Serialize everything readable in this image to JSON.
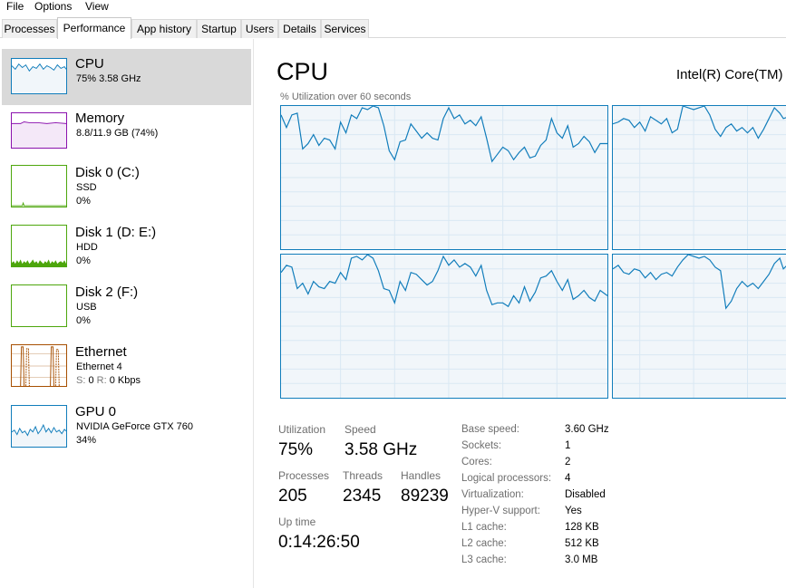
{
  "menu": [
    "File",
    "Options",
    "View"
  ],
  "tabs": [
    {
      "label": "Processes",
      "active": false
    },
    {
      "label": "Performance",
      "active": true
    },
    {
      "label": "App history",
      "active": false
    },
    {
      "label": "Startup",
      "active": false
    },
    {
      "label": "Users",
      "active": false
    },
    {
      "label": "Details",
      "active": false
    },
    {
      "label": "Services",
      "active": false
    }
  ],
  "sidebar": {
    "items": [
      {
        "title": "CPU",
        "line1": "75% 3.58 GHz",
        "color": "#117dbb",
        "icon": "cpu-graph"
      },
      {
        "title": "Memory",
        "line1": "8.8/11.9 GB (74%)",
        "color": "#8b12ae",
        "icon": "memory-graph"
      },
      {
        "title": "Disk 0 (C:)",
        "line1": "SSD",
        "line2": "0%",
        "color": "#4da60c",
        "icon": "disk-graph"
      },
      {
        "title": "Disk 1 (D: E:)",
        "line1": "HDD",
        "line2": "0%",
        "color": "#4da60c",
        "icon": "disk-graph"
      },
      {
        "title": "Disk 2 (F:)",
        "line1": "USB",
        "line2": "0%",
        "color": "#4da60c",
        "icon": "disk-graph"
      },
      {
        "title": "Ethernet",
        "line1": "Ethernet 4",
        "send_label": "S:",
        "send_value": "0",
        "recv_label": "R:",
        "recv_value": "0 Kbps",
        "color": "#a74f01",
        "icon": "network-graph"
      },
      {
        "title": "GPU 0",
        "line1": "NVIDIA GeForce GTX 760",
        "line2": "34%",
        "color": "#117dbb",
        "icon": "gpu-graph"
      }
    ]
  },
  "main": {
    "title": "CPU",
    "model": "Intel(R) Core(TM)",
    "util_label": "% Utilization over 60 seconds",
    "graph_color": "#117dbb",
    "stats": {
      "utilization": {
        "label": "Utilization",
        "value": "75%"
      },
      "speed": {
        "label": "Speed",
        "value": "3.58 GHz"
      },
      "processes": {
        "label": "Processes",
        "value": "205"
      },
      "threads": {
        "label": "Threads",
        "value": "2345"
      },
      "handles": {
        "label": "Handles",
        "value": "89239"
      },
      "uptime": {
        "label": "Up time",
        "value": "0:14:26:50"
      }
    },
    "specs": [
      {
        "label": "Base speed:",
        "value": "3.60 GHz"
      },
      {
        "label": "Sockets:",
        "value": "1"
      },
      {
        "label": "Cores:",
        "value": "2"
      },
      {
        "label": "Logical processors:",
        "value": "4"
      },
      {
        "label": "Virtualization:",
        "value": "Disabled"
      },
      {
        "label": "Hyper-V support:",
        "value": "Yes"
      },
      {
        "label": "L1 cache:",
        "value": "128 KB"
      },
      {
        "label": "L2 cache:",
        "value": "512 KB"
      },
      {
        "label": "L3 cache:",
        "value": "3.0 MB"
      }
    ]
  }
}
